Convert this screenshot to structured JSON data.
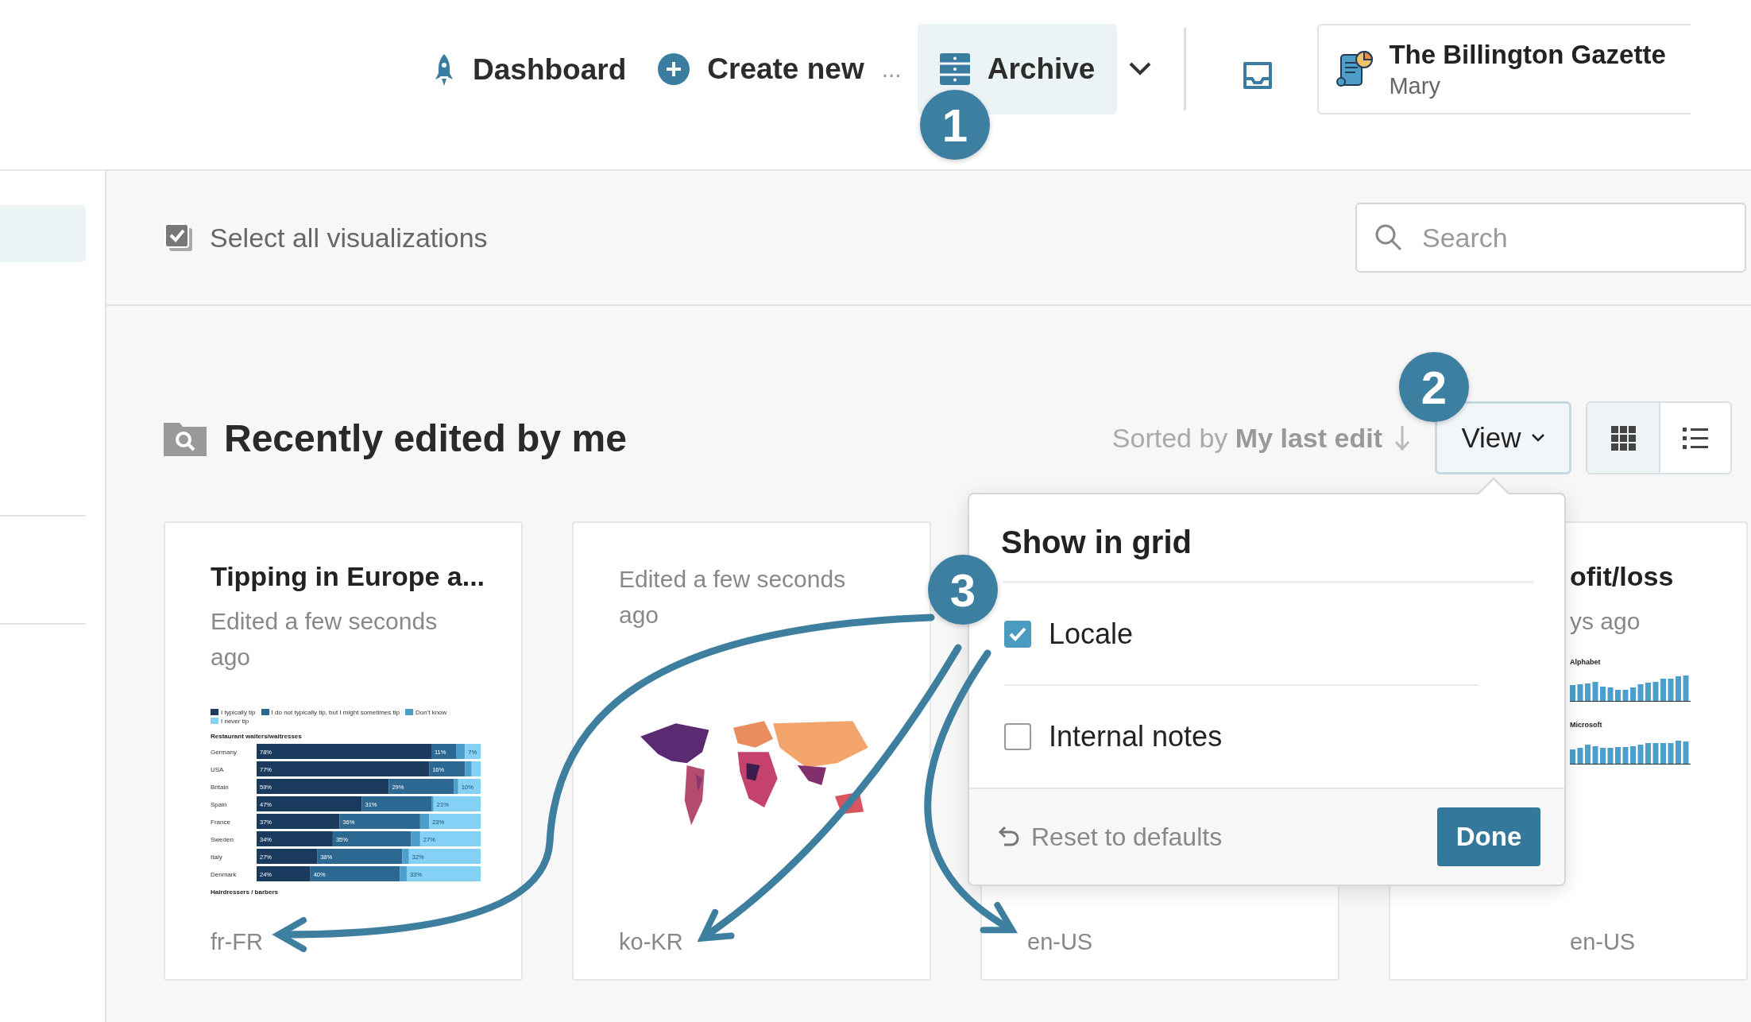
{
  "nav": {
    "items": [
      {
        "kind": "dashboard",
        "label": "Dashboard",
        "selected": false
      },
      {
        "kind": "create",
        "label": "Create new",
        "suffix": "...",
        "selected": false
      },
      {
        "kind": "archive",
        "label": "Archive",
        "selected": true
      }
    ],
    "account": {
      "name": "The Billington Gazette",
      "user": "Mary"
    }
  },
  "sidebar": {
    "items": [
      {
        "selected": true
      }
    ]
  },
  "toolbar": {
    "select_all": "Select all visualizations",
    "search": {
      "placeholder": "Search"
    }
  },
  "section": {
    "title": "Recently edited by me",
    "sort": "Sorted by **My last edit**",
    "view_button": "View",
    "layouts": [
      {
        "kind": "grid",
        "selected": true
      },
      {
        "kind": "list",
        "selected": false
      }
    ]
  },
  "cards": [
    {
      "kind": "chart",
      "title": "Tipping in Europe a...",
      "subtitle": "Edited a few seconds ago",
      "locale": "fr-FR",
      "chart_data": {
        "type": "bar",
        "orientation": "horizontal",
        "stacked": true,
        "legend": "top",
        "title": "Restaurant waiters/waitresses",
        "categories": [
          "Germany",
          "USA",
          "Britain",
          "Spain",
          "France",
          "Sweden",
          "Italy",
          "Denmark"
        ],
        "series": [
          {
            "name": "I typically tip",
            "color": "#1a3a5e",
            "values": [
              78,
              77,
              59,
              47,
              37,
              34,
              27,
              24
            ],
            "value_labels": [
              "78%",
              "77%",
              "59%",
              "47%",
              "37%",
              "34%",
              "27%",
              "24%"
            ]
          },
          {
            "name": "I do not typically tip, but I might sometimes tip",
            "color": "#2d6892",
            "values": [
              11,
              16,
              29,
              31,
              36,
              35,
              38,
              40
            ],
            "value_labels": [
              "11%",
              "16%",
              "29%",
              "31%",
              "36%",
              "35%",
              "38%",
              "40%"
            ]
          },
          {
            "name": "Don't know",
            "color": "#4b9fca",
            "values": [
              4,
              3,
              2,
              1,
              4,
              4,
              3,
              3
            ],
            "value_labels": [
              null,
              null,
              null,
              null,
              null,
              null,
              null,
              null
            ]
          },
          {
            "name": "I never tip",
            "color": "#85d1f5",
            "values": [
              7,
              4,
              10,
              21,
              23,
              27,
              32,
              33
            ],
            "value_labels": [
              "7%",
              null,
              "10%",
              "21%",
              "23%",
              "27%",
              "32%",
              "33%"
            ]
          }
        ]
      },
      "next_section": "Hairdressers / barbers"
    },
    {
      "kind": "map",
      "subtitle": "Edited a few seconds ago",
      "locale": "ko-KR"
    },
    {
      "kind": "hidden",
      "locale": "en-US"
    },
    {
      "kind": "stocks",
      "title": "ofit/loss",
      "subtitle": "ys ago",
      "charts": [
        "Alphabet",
        "Microsoft"
      ],
      "locale": "en-US"
    }
  ],
  "popup": {
    "title": "Show in grid",
    "options": [
      {
        "label": "Locale",
        "checked": true
      },
      {
        "label": "Internal notes",
        "checked": false
      }
    ],
    "reset": "Reset to defaults",
    "done": "Done"
  },
  "annotations": [
    {
      "label": "1"
    },
    {
      "label": "2"
    },
    {
      "label": "3"
    }
  ]
}
